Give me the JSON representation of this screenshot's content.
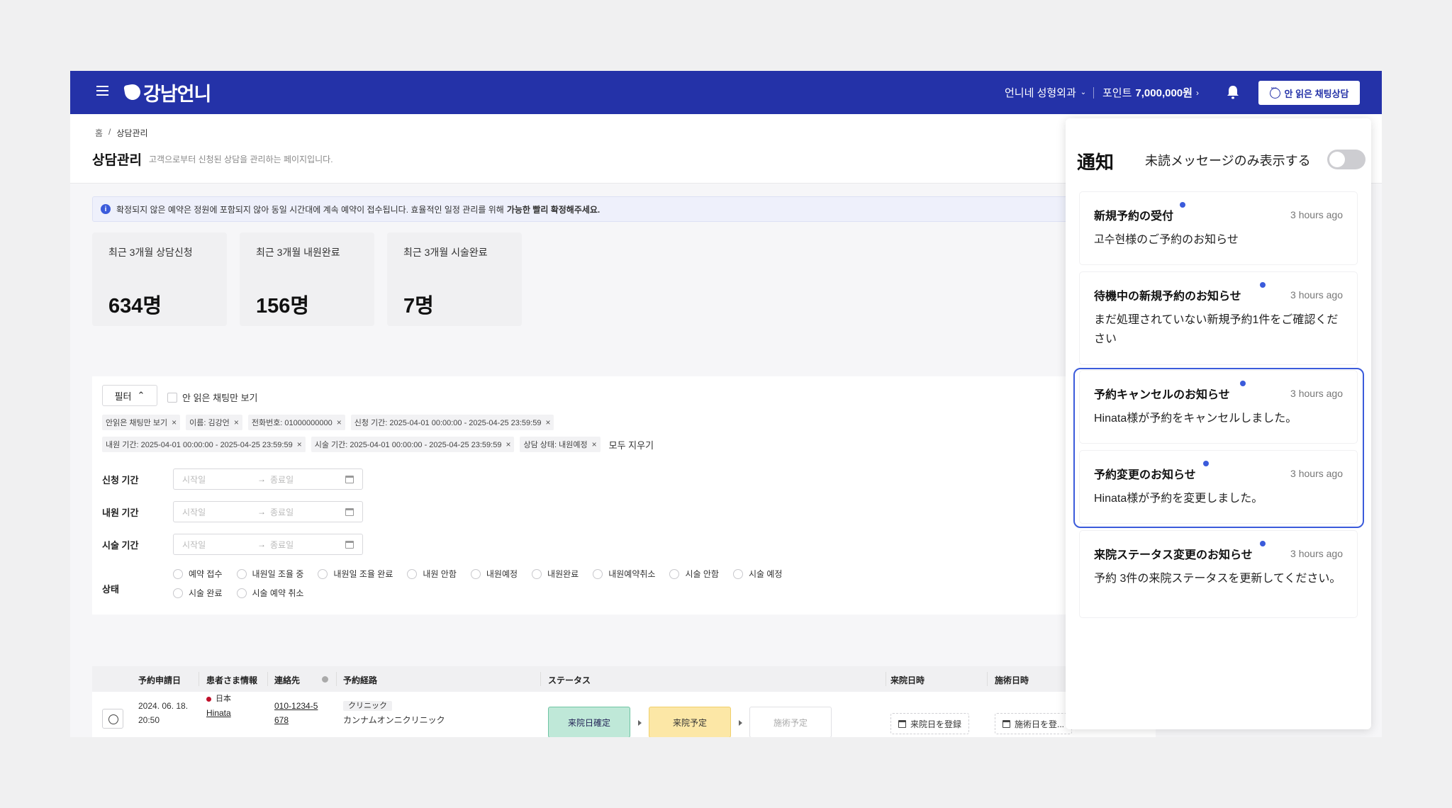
{
  "header": {
    "logo_text": "강남언니",
    "hospital_name": "언니네 성형외과",
    "points_label": "포인트",
    "points_value": "7,000,000원",
    "chat_button": "안 읽은 채팅상담",
    "brand_color": "#2432a8"
  },
  "breadcrumb": {
    "home": "홈",
    "separator": "/",
    "current": "상담관리"
  },
  "page": {
    "title": "상담관리",
    "description": "고객으로부터 신청된 상담을 관리하는 페이지입니다."
  },
  "notice": {
    "icon": "i",
    "text": "확정되지 않은 예약은 정원에 포함되지 않아 동일 시간대에 계속 예약이 접수됩니다. 효율적인 일정 관리를 위해",
    "emphasis": "가능한 빨리 확정해주세요."
  },
  "stats": [
    {
      "label": "최근 3개월 상담신청",
      "value": "634명"
    },
    {
      "label": "최근 3개월 내원완료",
      "value": "156명"
    },
    {
      "label": "최근 3개월 시술완료",
      "value": "7명"
    }
  ],
  "filter": {
    "button_label": "필터",
    "unread_only_label": "안 읽은 채팅만 보기",
    "tags_row1": [
      "안읽은 채팅만 보기",
      "이름: 김강언",
      "전화번호: 01000000000",
      "신청 기간: 2025-04-01 00:00:00 - 2025-04-25 23:59:59"
    ],
    "tags_row2": [
      "내원 기간: 2025-04-01 00:00:00 - 2025-04-25 23:59:59",
      "시술 기간: 2025-04-01 00:00:00 - 2025-04-25 23:59:59",
      "상담 상태: 내원예정"
    ],
    "tag_close": "×",
    "clear_all": "모두 지우기",
    "date_rows": [
      {
        "label": "신청 기간",
        "start_placeholder": "시작일",
        "end_placeholder": "종료일"
      },
      {
        "label": "내원 기간",
        "start_placeholder": "시작일",
        "end_placeholder": "종료일"
      },
      {
        "label": "시술 기간",
        "start_placeholder": "시작일",
        "end_placeholder": "종료일"
      }
    ],
    "arrow": "→",
    "status_label": "상태",
    "status_row1": [
      "예약 접수",
      "내원일 조율 중",
      "내원일 조율 완료",
      "내원 안함",
      "내원예정",
      "내원완료",
      "내원예약취소",
      "시술 안함",
      "시술 예정"
    ],
    "status_row2": [
      "시술 완료",
      "시술 예약 취소"
    ]
  },
  "table": {
    "headers": [
      "予約申請日",
      "患者さま情報",
      "連絡先",
      "予約経路",
      "ステータス",
      "来院日時",
      "施術日時"
    ],
    "row": {
      "date": "2024. 06. 18.",
      "time": "20:50",
      "country": "日本",
      "name": "Hinata",
      "phone1": "010-1234-5",
      "phone2": "678",
      "route_tag": "クリニック",
      "route": "カンナムオンニクリニック",
      "steps": [
        "来院日確定",
        "来院予定",
        "施術予定"
      ],
      "visit_button": "来院日を登録",
      "treat_button": "施術日を登..."
    }
  },
  "notifications": {
    "title": "通知",
    "toggle_label": "未読メッセージのみ表示する",
    "toggle_on": false,
    "items": [
      {
        "title": "新規予約の受付",
        "time": "3 hours ago",
        "body": "고수현様のご予約のお知らせ"
      },
      {
        "title": "待機中の新規予約のお知らせ",
        "time": "3 hours ago",
        "body": "まだ処理されていない新規予約1件をご確認ください"
      },
      {
        "title": "予約キャンセルのお知らせ",
        "time": "3 hours ago",
        "body": "Hinata様が予約をキャンセルしました。"
      },
      {
        "title": "予約変更のお知らせ",
        "time": "3 hours ago",
        "body": "Hinata様が予約を変更しました。"
      },
      {
        "title": "来院ステータス変更のお知らせ",
        "time": "3 hours ago",
        "body": "予約 3件の来院ステータスを更新してください。"
      }
    ]
  }
}
